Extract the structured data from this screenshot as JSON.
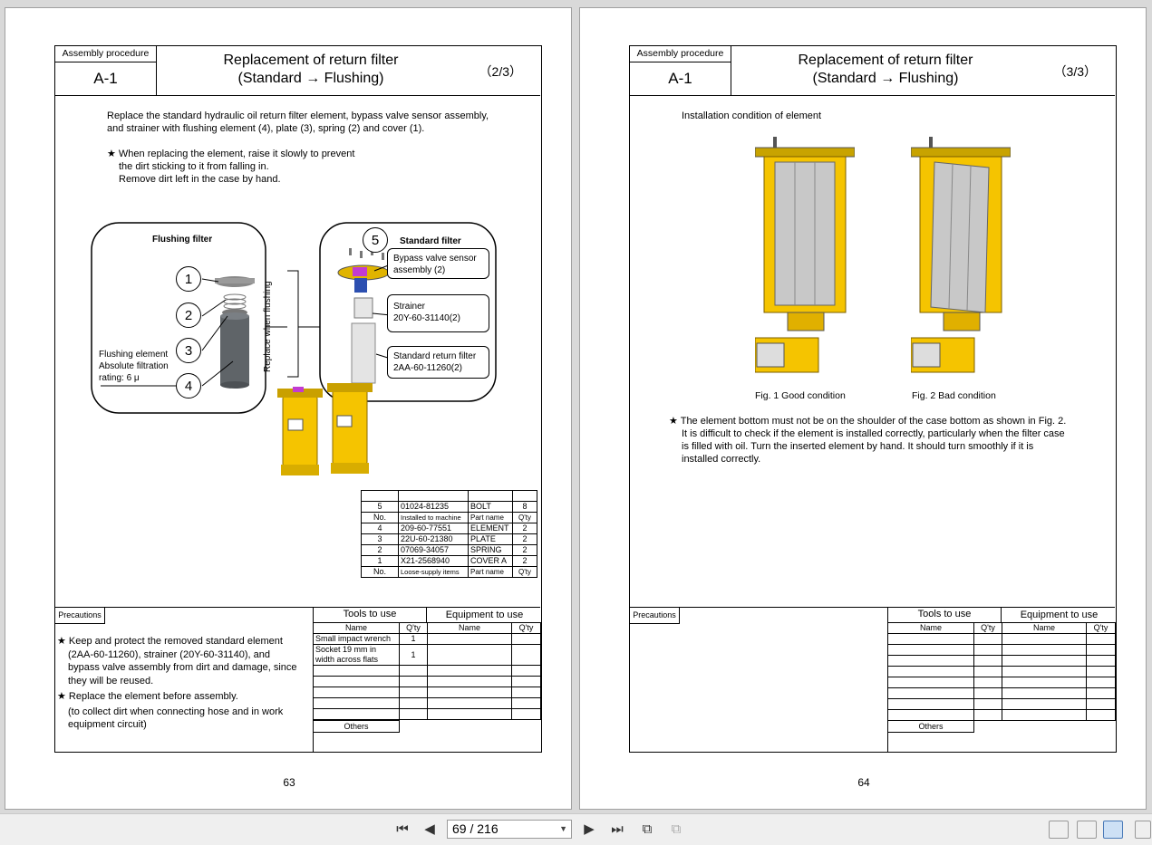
{
  "pages": {
    "left": {
      "header": {
        "proc_label": "Assembly procedure",
        "code": "A-1",
        "title_line1": "Replacement of return filter",
        "title_line2": "(Standard → Flushing)",
        "page": "（2/3）"
      },
      "intro_line1": "Replace the standard hydraulic oil return filter element, bypass valve sensor assembly,",
      "intro_line2": "and strainer with flushing element (4), plate (3), spring (2) and cover (1).",
      "note_line1": "★ When replacing the element, raise it slowly to prevent",
      "note_line2": "the dirt sticking to it from falling in.",
      "note_line3": "Remove dirt left in the case by hand.",
      "figure": {
        "flushing_title": "Flushing filter",
        "standard_title": "Standard filter",
        "replace_label": "Replace when flushing",
        "flushing_el_1": "Flushing element",
        "flushing_el_2": "Absolute filtration",
        "flushing_el_3": "rating: 6 μ",
        "bypass_1": "Bypass valve sensor",
        "bypass_2": "assembly (2)",
        "strainer_1": "Strainer",
        "strainer_2": "20Y-60-31140(2)",
        "std_filter_1": "Standard return filter",
        "std_filter_2": "2AA-60-11260(2)",
        "n1": "1",
        "n2": "2",
        "n3": "3",
        "n4": "4",
        "n5": "5"
      },
      "parts": [
        [
          "5",
          "01024-81235",
          "BOLT",
          "8"
        ],
        [
          "No.",
          "Installed to machine",
          "Part name",
          "Q'ty"
        ],
        [
          "4",
          "209-60-77551",
          "ELEMENT",
          "2"
        ],
        [
          "3",
          "22U-60-21380",
          "PLATE",
          "2"
        ],
        [
          "2",
          "07069-34057",
          "SPRING",
          "2"
        ],
        [
          "1",
          "X21-2568940",
          "COVER A",
          "2"
        ],
        [
          "No.",
          "Loose-supply items",
          "Part name",
          "Q'ty"
        ]
      ],
      "precautions_label": "Precautions",
      "prec_1a": "★ Keep and protect the removed standard element",
      "prec_1b": "(2AA-60-11260), strainer (20Y-60-31140), and",
      "prec_1c": "bypass valve assembly from dirt and damage, since",
      "prec_1d": "they will be reused.",
      "prec_2a": "★ Replace the element before assembly.",
      "prec_2b": "(to collect dirt when connecting hose and in work",
      "prec_2c": "equipment circuit)",
      "tools": {
        "tools_to_use": "Tools to use",
        "equipment_to_use": "Equipment  to use",
        "name": "Name",
        "qty": "Q'ty",
        "others": "Others",
        "t1": "Small impact wrench",
        "t1q": "1",
        "t2a": "Socket 19 mm in",
        "t2b": "width across flats",
        "t2q": "1"
      },
      "page_number": "63"
    },
    "right": {
      "header": {
        "proc_label": "Assembly procedure",
        "code": "A-1",
        "title_line1": "Replacement of return filter",
        "title_line2": "(Standard → Flushing)",
        "page": "（3/3）"
      },
      "install_title": "Installation condition of element",
      "fig1": "Fig. 1 Good condition",
      "fig2": "Fig. 2 Bad condition",
      "note_1": "★ The element bottom must not be on the shoulder of the case bottom as shown in Fig. 2.",
      "note_2": "It is difficult to check if the element is installed correctly, particularly when the filter case",
      "note_3": "is filled with oil. Turn the inserted element by hand. It should turn smoothly if it is",
      "note_4": "installed correctly.",
      "precautions_label": "Precautions",
      "tools": {
        "tools_to_use": "Tools to use",
        "equipment_to_use": "Equipment  to use",
        "name": "Name",
        "qty": "Q'ty",
        "others": "Others"
      },
      "page_number": "64"
    }
  },
  "toolbar": {
    "page_field": "69 / 216"
  },
  "colors": {
    "filter_yellow": "#f5c400",
    "element_gray": "#c8c8c8",
    "background": "#d9d9d9"
  }
}
